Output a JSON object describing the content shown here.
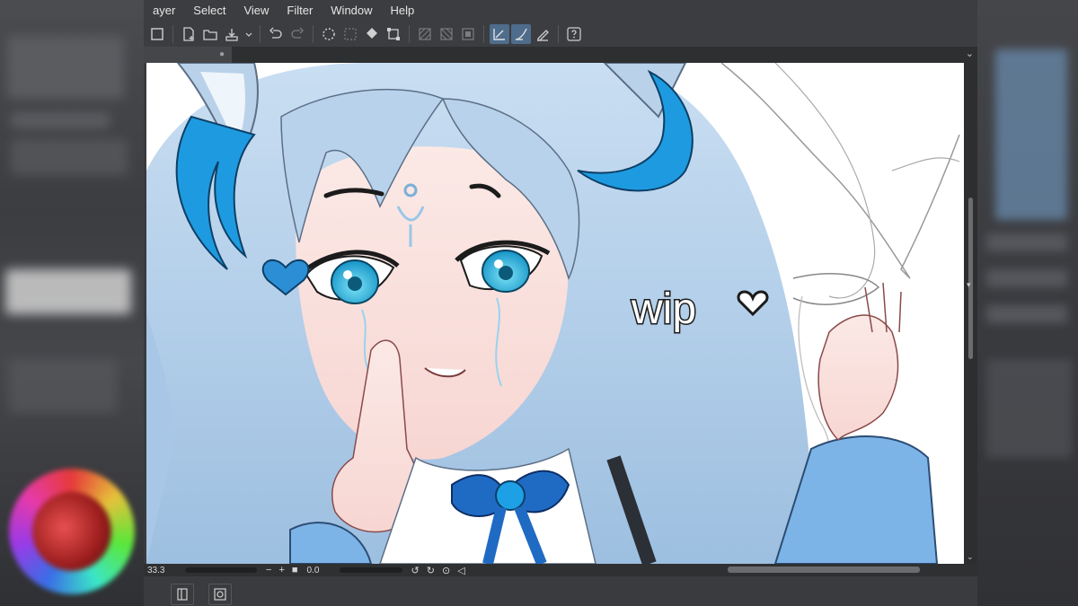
{
  "menu": {
    "items": [
      "ayer",
      "Select",
      "View",
      "Filter",
      "Window",
      "Help"
    ]
  },
  "toolbar": {
    "icons": [
      "panel-icon",
      "new-file-icon",
      "open-folder-icon",
      "save-icon",
      "undo-icon",
      "redo-icon",
      "loading-icon",
      "deselect-icon",
      "fill-icon",
      "transform-icon",
      "hatch-icon",
      "hatch2-icon",
      "hatch3-icon",
      "ruler-snap-icon",
      "curve-snap-icon",
      "pen-snap-icon",
      "help-icon"
    ]
  },
  "artwork": {
    "wip_text": "wip"
  },
  "status": {
    "zoom": "33.3",
    "angle": "0.0",
    "minus": "−",
    "plus": "+"
  },
  "colors": {
    "panel_bg": "#3c3d40",
    "active_tool": "#4e6c8c",
    "hair_blue": "#a9c9e6",
    "horn_blue": "#1e9be0"
  }
}
